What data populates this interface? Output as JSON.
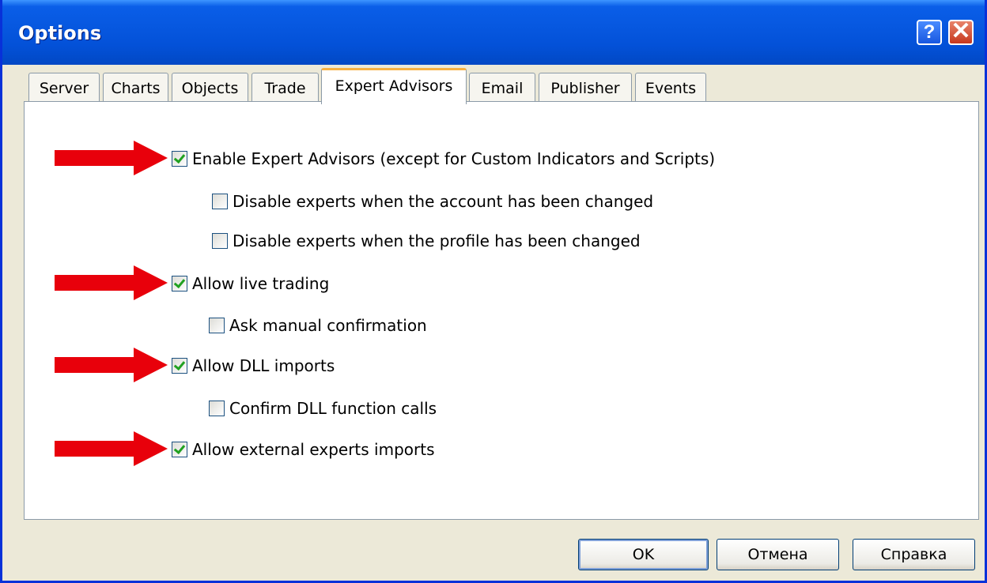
{
  "window": {
    "title": "Options"
  },
  "title_buttons": {
    "help": "?",
    "close": "✕"
  },
  "tabs": [
    {
      "label": "Server"
    },
    {
      "label": "Charts"
    },
    {
      "label": "Objects"
    },
    {
      "label": "Trade"
    },
    {
      "label": "Expert Advisors",
      "active": true
    },
    {
      "label": "Email"
    },
    {
      "label": "Publisher"
    },
    {
      "label": "Events"
    }
  ],
  "options": [
    {
      "label": "Enable Expert Advisors (except for Custom Indicators and Scripts)",
      "checked": true
    },
    {
      "label": "Disable experts when the account has been changed",
      "checked": false
    },
    {
      "label": "Disable experts when the profile has been changed",
      "checked": false
    },
    {
      "label": "Allow live trading",
      "checked": true
    },
    {
      "label": "Ask manual confirmation",
      "checked": false
    },
    {
      "label": "Allow DLL imports",
      "checked": true
    },
    {
      "label": "Confirm DLL function calls",
      "checked": false
    },
    {
      "label": "Allow external experts imports",
      "checked": true
    }
  ],
  "buttons": {
    "ok": "OK",
    "cancel": "Отмена",
    "help": "Справка"
  },
  "colors": {
    "titlebar": "#0a5ee8",
    "arrow": "#e8000b",
    "check": "#21a121",
    "active_tab_accent": "#f7b142"
  }
}
